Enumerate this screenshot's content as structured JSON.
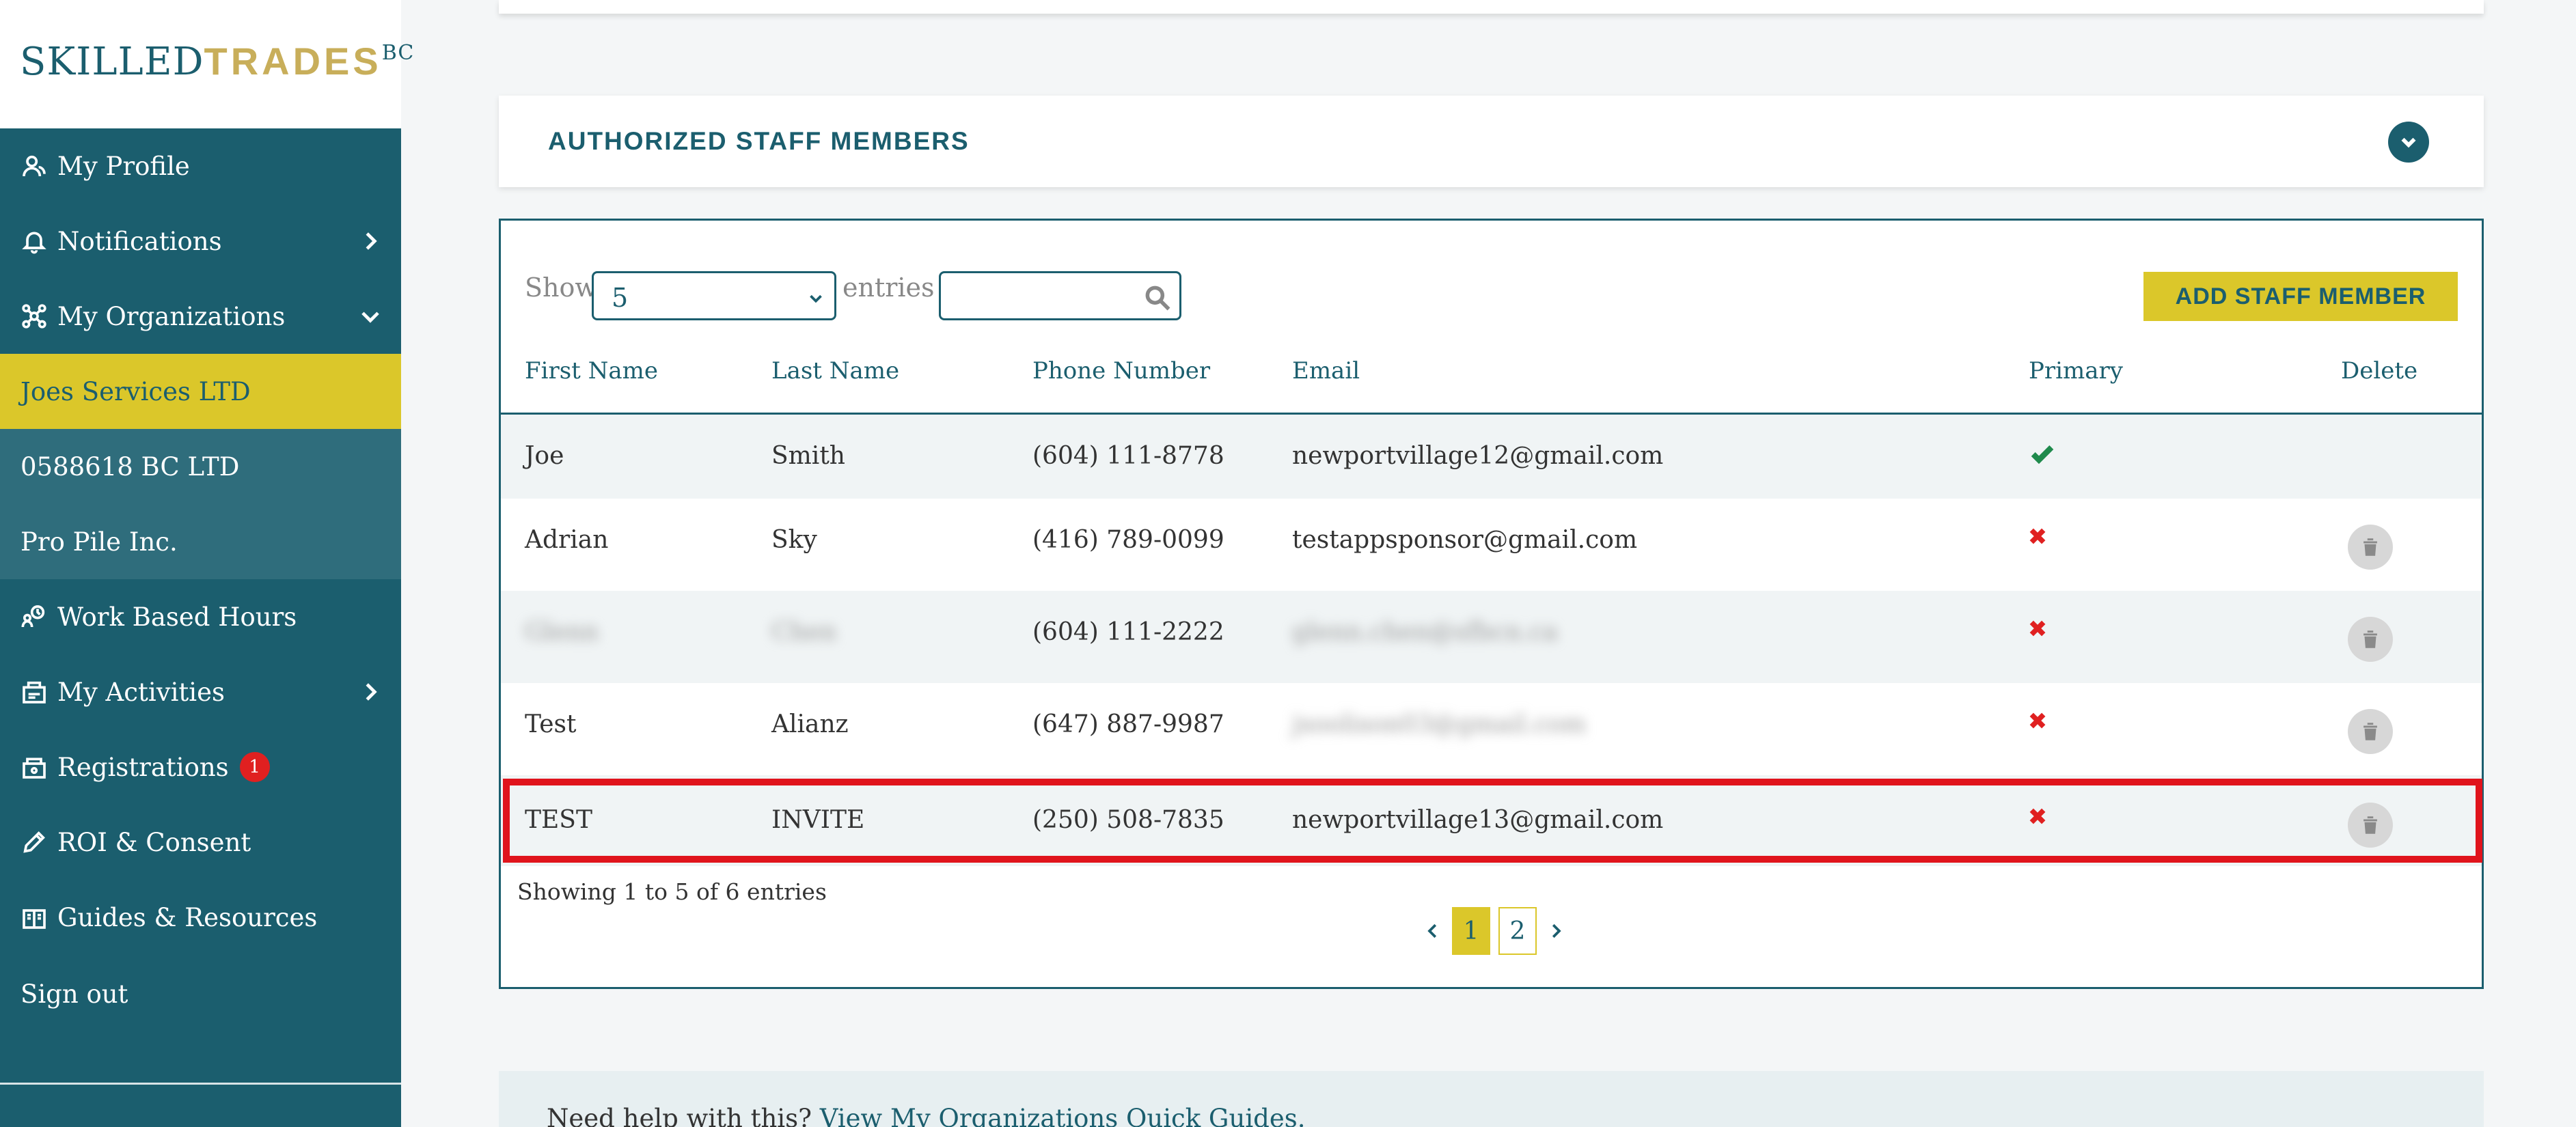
{
  "logo": {
    "part1": "SKILLED",
    "part2": "TRADES",
    "superscript": "BC"
  },
  "sidebar": {
    "items": [
      {
        "label": "My Profile",
        "icon": "user-icon"
      },
      {
        "label": "Notifications",
        "icon": "bell-icon",
        "chevron": "right"
      },
      {
        "label": "My Organizations",
        "icon": "network-icon",
        "chevron": "down"
      },
      {
        "label": "Joes Services LTD",
        "active": true
      },
      {
        "label": "0588618 BC LTD"
      },
      {
        "label": "Pro Pile Inc."
      },
      {
        "label": "Work Based Hours",
        "icon": "clock-people-icon"
      },
      {
        "label": "My Activities",
        "icon": "activities-icon",
        "chevron": "right"
      },
      {
        "label": "Registrations",
        "icon": "registrations-icon",
        "badge": "1"
      },
      {
        "label": "ROI & Consent",
        "icon": "pencil-icon"
      },
      {
        "label": "Guides & Resources",
        "icon": "book-icon"
      }
    ],
    "sign_out": "Sign out"
  },
  "accordion": {
    "title": "AUTHORIZED STAFF MEMBERS"
  },
  "table_controls": {
    "show_label": "Show",
    "entries_value": "5",
    "entries_label": "entries",
    "search_value": "",
    "add_button": "ADD STAFF MEMBER"
  },
  "table": {
    "headers": [
      "First Name",
      "Last Name",
      "Phone Number",
      "Email",
      "Primary",
      "Delete"
    ],
    "rows": [
      {
        "first": "Joe",
        "last": "Smith",
        "phone": "(604) 111-8778",
        "email": "newportvillage12@gmail.com",
        "primary": true
      },
      {
        "first": "Adrian",
        "last": "Sky",
        "phone": "(416) 789-0099",
        "email": "testappsponsor@gmail.com",
        "primary": false
      },
      {
        "first": "Glenn",
        "last": "Chen",
        "phone": "(604) 111-2222",
        "email": "glenn.chen@sfbcn.ca",
        "primary": false
      },
      {
        "first": "Test",
        "last": "Alianz",
        "phone": "(647) 887-9987",
        "email": "jsoolison03@gmail.com",
        "primary": false
      },
      {
        "first": "TEST",
        "last": "INVITE",
        "phone": "(250) 508-7835",
        "email": "newportvillage13@gmail.com",
        "primary": false
      }
    ],
    "info": "Showing 1 to 5 of 6 entries",
    "pages": [
      "1",
      "2"
    ],
    "current_page": "1"
  },
  "help": {
    "text": "Need help with this?",
    "link": "View My Organizations Quick Guides."
  },
  "colors": {
    "primary": "#1b5e6e",
    "accent": "#dbc72a",
    "danger": "#e02020",
    "success": "#1f8a4c"
  }
}
